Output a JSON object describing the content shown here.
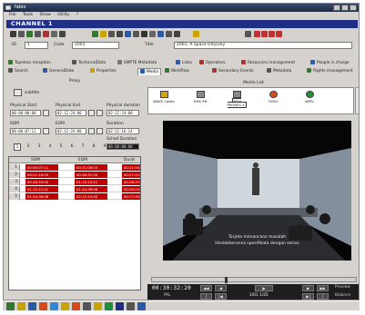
{
  "window": {
    "title": "fabio"
  },
  "menu": [
    "File",
    "Tools",
    "Show",
    "Utility",
    "?"
  ],
  "channel": {
    "label": "CHANNEL 1"
  },
  "info": {
    "id_label": "ID",
    "id_value": "1",
    "code_label": "Code",
    "code_value": "2001",
    "title_label": "Title",
    "title_value": "2001: A Space Odyssey"
  },
  "tabs_row1": [
    "Tapeless reception",
    "TechnicalData",
    "SMPTE Metadata",
    "Links",
    "Operators",
    "Resources management",
    "People in charge"
  ],
  "tabs_row2": [
    "Search",
    "GeneralData",
    "Properties",
    "Media",
    "Workflow",
    "Secondary Events",
    "Metadata",
    "Rights management"
  ],
  "proxy": {
    "heading": "Proxy",
    "subtitle_label": "subtitle",
    "physical_start_label": "Physical Start",
    "physical_start_value": "00:00:00:00",
    "physical_end_label": "Physical End",
    "physical_end_value": "02:12:24:00",
    "physical_duration_label": "Physical duration",
    "physical_duration_value": "02:12:24:00",
    "som_label": "SOM",
    "som_value": "00:00:07:11",
    "eom_label": "EOM",
    "eom_value": "02:12:24:00",
    "duration_label": "Duration",
    "duration_value": "02:12:16:14",
    "selected_duration_label": "Sched Duration",
    "selected_duration_value": "00:00:00:00",
    "segment_numbers": [
      "1",
      "2",
      "3",
      "4",
      "5",
      "6",
      "7",
      "8",
      "9"
    ],
    "selected_segment": "1"
  },
  "segments": {
    "headers": [
      "SOM",
      "EOM",
      "Durat"
    ],
    "rows": [
      {
        "n": "1",
        "som": "00:00:07:11",
        "eom": "00:21:08:03",
        "dur": "00:21:00:17"
      },
      {
        "n": "2",
        "som": "00:21:10:03",
        "eom": "00:48:31:05",
        "dur": "00:27:21:02"
      },
      {
        "n": "3",
        "som": "00:48:33:05",
        "eom": "01:15:10:21",
        "dur": "00:26:37:16"
      },
      {
        "n": "4",
        "som": "01:15:12:21",
        "eom": "01:44:36:08",
        "dur": "00:29:23:12"
      },
      {
        "n": "5",
        "som": "01:44:38:08",
        "eom": "02:12:24:00",
        "dur": "00:27:45:17"
      }
    ]
  },
  "media_list": {
    "heading": "Media List",
    "items": [
      {
        "label": "WAVE Codec",
        "icon": "audio-file-icon",
        "color": "#d9a800"
      },
      {
        "label": "BHK 96",
        "icon": "film-file-icon",
        "color": "#8a8a8a"
      },
      {
        "label": "MOV PRORES 4",
        "icon": "film-file-icon",
        "color": "#8a8a8a"
      },
      {
        "label": "H264",
        "icon": "media-player-icon",
        "color": "#d94a1a"
      },
      {
        "label": "WMV",
        "icon": "media-player-icon",
        "color": "#1f8f3a"
      }
    ],
    "selected": "MOV PRORES 4"
  },
  "player": {
    "subtitle_line1": "Tarjeta menancanz masalah",
    "subtitle_line2": "Hindakkerannz spesifikata dengan serius",
    "timecode": "00:30:32:20",
    "pal_label": "PAL",
    "speed_label": "1/01 1/25",
    "preview_label": "Preview",
    "balance_label": "Balance",
    "seek_position": 0.36
  },
  "colors": {
    "channel_bar": "#1f2f86",
    "grid_row_fill": "#c00000",
    "accent_tab": "#f4f4f4"
  }
}
